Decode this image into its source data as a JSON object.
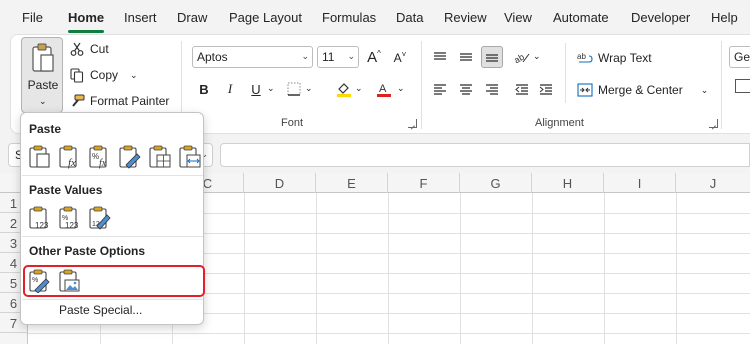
{
  "menu": {
    "tabs": [
      {
        "label": "File"
      },
      {
        "label": "Home",
        "active": true
      },
      {
        "label": "Insert"
      },
      {
        "label": "Draw"
      },
      {
        "label": "Page Layout"
      },
      {
        "label": "Formulas"
      },
      {
        "label": "Data"
      },
      {
        "label": "Review"
      },
      {
        "label": "View"
      },
      {
        "label": "Automate"
      },
      {
        "label": "Developer"
      },
      {
        "label": "Help"
      }
    ]
  },
  "clipboard": {
    "paste_label": "Paste",
    "cut_label": "Cut",
    "copy_label": "Copy",
    "format_painter_label": "Format Painter"
  },
  "font": {
    "group_label": "Font",
    "name": "Aptos",
    "size": "11",
    "bold": "B",
    "italic": "I",
    "underline": "U"
  },
  "alignment": {
    "group_label": "Alignment",
    "wrap_text_label": "Wrap Text",
    "merge_center_label": "Merge & Center"
  },
  "number": {
    "format_partial": "Ger"
  },
  "namebox": {
    "value": "S"
  },
  "grid": {
    "columns": [
      "C",
      "D",
      "E",
      "F",
      "G",
      "H",
      "I",
      "J"
    ],
    "rows": [
      "1",
      "2",
      "3",
      "4",
      "5",
      "6",
      "7"
    ]
  },
  "paste_menu": {
    "paste_title": "Paste",
    "paste_values_title": "Paste Values",
    "other_title": "Other Paste Options",
    "paste_special_label": "Paste Special...",
    "icons_paste": [
      "paste-icon",
      "paste-formulas-icon",
      "paste-formulas-number-format-icon",
      "keep-source-formatting-icon",
      "no-borders-icon",
      "keep-column-widths-icon"
    ],
    "icons_values": [
      "paste-values-icon",
      "values-number-format-icon",
      "values-source-formatting-icon"
    ],
    "icons_other": [
      "formatting-icon",
      "picture-icon"
    ]
  },
  "colors": {
    "accent": "#107c41",
    "highlight": "#e0202a",
    "fill_yellow": "#ffd800",
    "font_red": "#e02020"
  }
}
